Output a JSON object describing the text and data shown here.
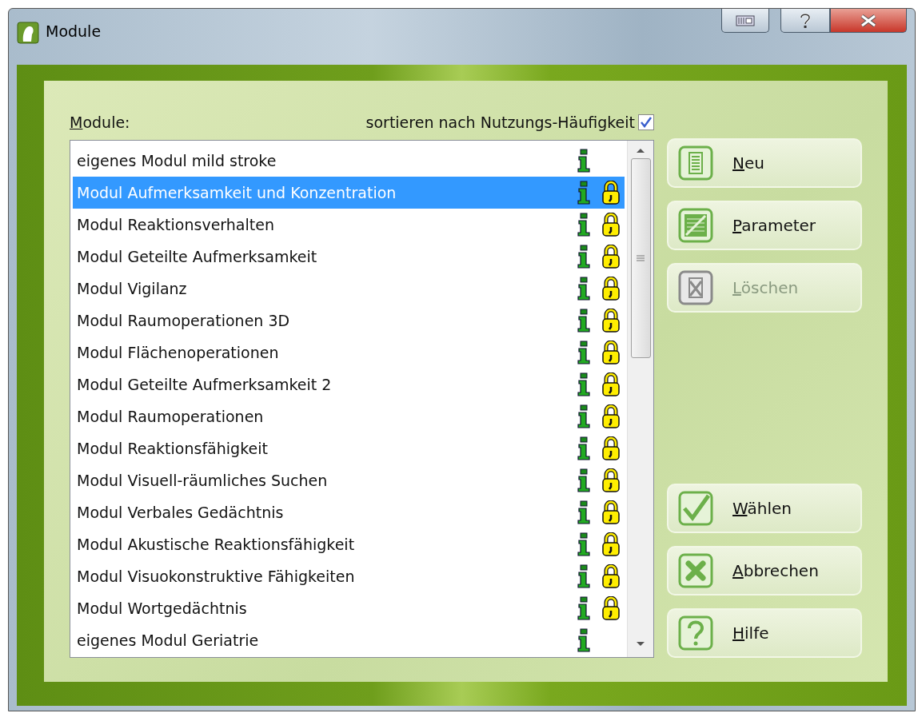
{
  "window": {
    "title": "Module"
  },
  "list_label": "Module:",
  "sort_option": {
    "label": "sortieren nach Nutzungs-Häufigkeit",
    "checked": true
  },
  "modules": [
    {
      "name": "eigenes Modul mild stroke",
      "selected": false,
      "locked": false
    },
    {
      "name": "Modul Aufmerksamkeit und Konzentration",
      "selected": true,
      "locked": true
    },
    {
      "name": "Modul Reaktionsverhalten",
      "selected": false,
      "locked": true
    },
    {
      "name": "Modul Geteilte Aufmerksamkeit",
      "selected": false,
      "locked": true
    },
    {
      "name": "Modul Vigilanz",
      "selected": false,
      "locked": true
    },
    {
      "name": "Modul Raumoperationen 3D",
      "selected": false,
      "locked": true
    },
    {
      "name": "Modul Flächenoperationen",
      "selected": false,
      "locked": true
    },
    {
      "name": "Modul Geteilte Aufmerksamkeit 2",
      "selected": false,
      "locked": true
    },
    {
      "name": "Modul Raumoperationen",
      "selected": false,
      "locked": true
    },
    {
      "name": "Modul Reaktionsfähigkeit",
      "selected": false,
      "locked": true
    },
    {
      "name": "Modul Visuell-räumliches Suchen",
      "selected": false,
      "locked": true
    },
    {
      "name": "Modul Verbales Gedächtnis",
      "selected": false,
      "locked": true
    },
    {
      "name": "Modul Akustische Reaktionsfähigkeit",
      "selected": false,
      "locked": true
    },
    {
      "name": "Modul Visuokonstruktive Fähigkeiten",
      "selected": false,
      "locked": true
    },
    {
      "name": "Modul Wortgedächtnis",
      "selected": false,
      "locked": true
    },
    {
      "name": "eigenes Modul Geriatrie",
      "selected": false,
      "locked": false
    }
  ],
  "top_buttons": [
    {
      "label": "Neu",
      "kind": "document",
      "disabled": false
    },
    {
      "label": "Parameter",
      "kind": "edit",
      "disabled": false
    },
    {
      "label": "Löschen",
      "kind": "delete",
      "disabled": true
    }
  ],
  "bottom_buttons": [
    {
      "label": "Wählen",
      "kind": "check",
      "disabled": false
    },
    {
      "label": "Abbrechen",
      "kind": "cancel",
      "disabled": false
    },
    {
      "label": "Hilfe",
      "kind": "help",
      "disabled": false
    }
  ]
}
